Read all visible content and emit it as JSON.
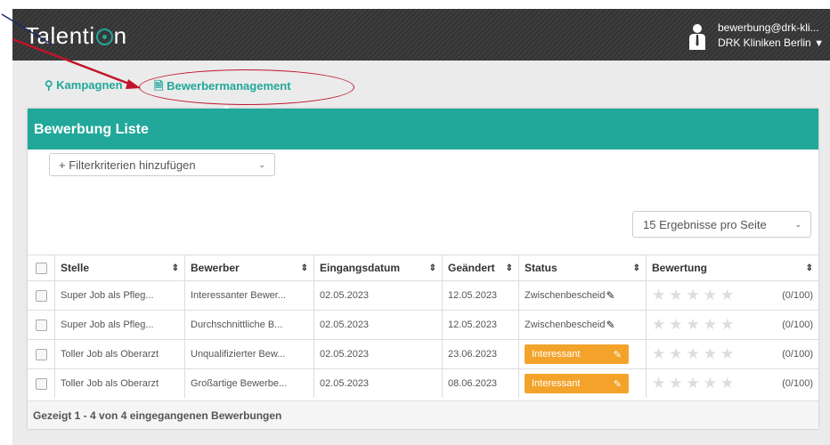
{
  "app": {
    "logo_text_1": "Talenti",
    "logo_text_2": "n"
  },
  "user": {
    "email": "bewerbung@drk-kli...",
    "org": "DRK Kliniken Berlin"
  },
  "nav": {
    "items": [
      {
        "label": "Kampagnen",
        "icon": "lightbulb-icon"
      },
      {
        "label": "Bewerbermanagement",
        "icon": "document-icon"
      }
    ]
  },
  "panel": {
    "title": "Bewerbung Liste",
    "filter_placeholder": "+ Filterkriterien hinzufügen",
    "per_page": "15 Ergebnisse pro Seite"
  },
  "table": {
    "headers": [
      "Stelle",
      "Bewerber",
      "Eingangsdatum",
      "Geändert",
      "Status",
      "Bewertung"
    ],
    "rows": [
      {
        "stelle": "Super Job als Pfleg...",
        "bewerber": "Interessanter Bewer...",
        "eingang": "02.05.2023",
        "geaendert": "12.05.2023",
        "status": "Zwischenbescheid",
        "status_style": "text",
        "score": "(0/100)"
      },
      {
        "stelle": "Super Job als Pfleg...",
        "bewerber": "Durchschnittliche B...",
        "eingang": "02.05.2023",
        "geaendert": "12.05.2023",
        "status": "Zwischenbescheid",
        "status_style": "text",
        "score": "(0/100)"
      },
      {
        "stelle": "Toller Job als Oberarzt",
        "bewerber": "Unqualifizierter Bew...",
        "eingang": "02.05.2023",
        "geaendert": "23.06.2023",
        "status": "Interessant",
        "status_style": "pill",
        "score": "(0/100)"
      },
      {
        "stelle": "Toller Job als Oberarzt",
        "bewerber": "Großartige Bewerbe...",
        "eingang": "02.05.2023",
        "geaendert": "08.06.2023",
        "status": "Interessant",
        "status_style": "pill",
        "score": "(0/100)"
      }
    ]
  },
  "footer": {
    "summary": "Gezeigt 1 - 4 von 4 eingegangenen Bewerbungen"
  },
  "colors": {
    "accent": "#21a89a",
    "status_orange": "#f3a32a",
    "annotation_red": "#c0152a"
  }
}
